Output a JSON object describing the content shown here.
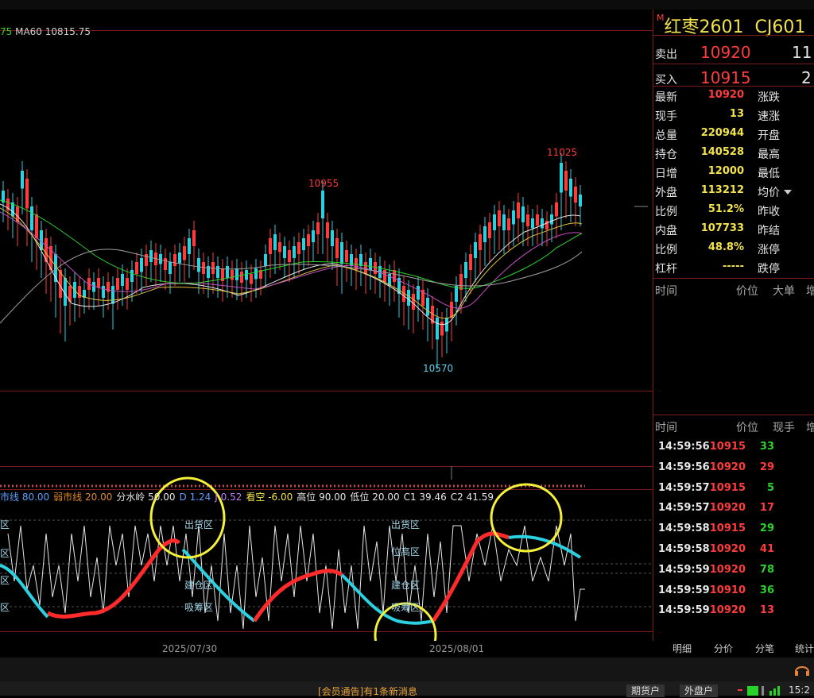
{
  "chart_header": {
    "ma_prev_suffix": "75",
    "ma60": "MA60 10815.75"
  },
  "price_annotations": {
    "high_right": "11025",
    "high_mid": "10955",
    "low": "10570"
  },
  "indicator_legend": {
    "items": [
      {
        "text": "市线 80.00",
        "color": "#5aa0ff"
      },
      {
        "text": "弱市线 20.00",
        "color": "#e08a2a"
      },
      {
        "text": "分水岭 50.00",
        "color": "#e6e6e6"
      },
      {
        "text": "D 1.24",
        "color": "#5aa0ff"
      },
      {
        "text": "J 0.52",
        "color": "#c080ff"
      },
      {
        "text": "看空 -6.00",
        "color": "#f2e34d"
      },
      {
        "text": "高位 90.00",
        "color": "#e6e6e6"
      },
      {
        "text": "低位 20.00",
        "color": "#e6e6e6"
      },
      {
        "text": "C1 39.46",
        "color": "#e6e6e6"
      },
      {
        "text": "C2 41.59",
        "color": "#e6e6e6"
      }
    ]
  },
  "zones": {
    "left_out": "区",
    "left_high": "区",
    "left_build": "区",
    "left_absorb": "区",
    "sell1": "出货区",
    "build1": "建仓区",
    "absorb1": "吸筹区",
    "sell2": "出货区",
    "high2": "位高区",
    "build2": "建仓区",
    "absorb2": "吸筹区"
  },
  "time_axis": {
    "t1": "2025/07/30",
    "t2": "2025/08/01"
  },
  "contract": {
    "m_badge": "M",
    "name": "红枣2601",
    "code": "CJ601"
  },
  "quote": {
    "sell_label": "卖出",
    "sell_price": "10920",
    "sell_vol": "11",
    "buy_label": "买入",
    "buy_price": "10915",
    "buy_vol": "2",
    "rows": [
      {
        "l1": "最新",
        "v1": "10920",
        "c1": "red",
        "l2": "涨跌"
      },
      {
        "l1": "现手",
        "v1": "13",
        "c1": "yel",
        "l2": "速涨"
      },
      {
        "l1": "总量",
        "v1": "220944",
        "c1": "yel",
        "l2": "开盘"
      },
      {
        "l1": "持仓",
        "v1": "140528",
        "c1": "yel",
        "l2": "最高"
      },
      {
        "l1": "日增",
        "v1": "12000",
        "c1": "yel",
        "l2": "最低"
      },
      {
        "l1": "外盘",
        "v1": "113212",
        "c1": "yel",
        "l2": "均价"
      },
      {
        "l1": "比例",
        "v1": "51.2%",
        "c1": "yel",
        "l2": "昨收"
      },
      {
        "l1": "内盘",
        "v1": "107733",
        "c1": "yel",
        "l2": "昨结"
      },
      {
        "l1": "比例",
        "v1": "48.8%",
        "c1": "yel",
        "l2": "涨停"
      },
      {
        "l1": "杠杆",
        "v1": "-----",
        "c1": "yel",
        "l2": "跌停"
      }
    ]
  },
  "bigorder_header": {
    "time": "时间",
    "price": "价位",
    "big": "大单",
    "more": "增"
  },
  "tick_header": {
    "time": "时间",
    "price": "价位",
    "vol": "现手",
    "more": "增"
  },
  "ticks": [
    {
      "time": "14:59:56",
      "price": "10915",
      "vol": "33",
      "vc": "grn"
    },
    {
      "time": "14:59:56",
      "price": "10920",
      "vol": "29",
      "vc": "red"
    },
    {
      "time": "14:59:57",
      "price": "10915",
      "vol": "5",
      "vc": "grn"
    },
    {
      "time": "14:59:57",
      "price": "10920",
      "vol": "17",
      "vc": "red"
    },
    {
      "time": "14:59:58",
      "price": "10915",
      "vol": "29",
      "vc": "grn"
    },
    {
      "time": "14:59:58",
      "price": "10920",
      "vol": "41",
      "vc": "red"
    },
    {
      "time": "14:59:59",
      "price": "10920",
      "vol": "78",
      "vc": "grn"
    },
    {
      "time": "14:59:59",
      "price": "10910",
      "vol": "36",
      "vc": "grn"
    },
    {
      "time": "14:59:59",
      "price": "10920",
      "vol": "13",
      "vc": "red"
    }
  ],
  "rp_tabs": [
    "明细",
    "分价",
    "分笔",
    "统计"
  ],
  "bottom": {
    "news": "[会员通告]有1条新消息",
    "btn1": "期货户",
    "btn2": "外盘户",
    "clock": "15:2"
  },
  "colors": {
    "up": "#ff3b3b",
    "down": "#2bd1e0",
    "grid": "#7a1a1a",
    "highlight": "#f5f03a"
  }
}
